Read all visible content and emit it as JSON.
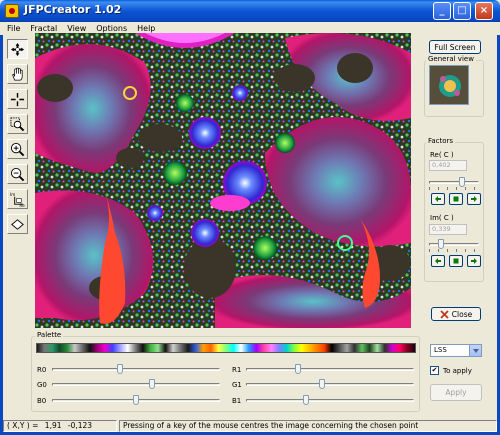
{
  "window": {
    "title": "JFPCreator 1.02"
  },
  "menu": [
    "File",
    "Fractal",
    "View",
    "Options",
    "Help"
  ],
  "toolbar": {
    "tools": [
      {
        "name": "centre-tool",
        "icon": "move-arrows-icon",
        "active": true
      },
      {
        "name": "pan-tool",
        "icon": "hand-icon"
      },
      {
        "name": "crosshair-tool",
        "icon": "crosshair-icon"
      },
      {
        "name": "zoom-region-tool",
        "icon": "zoom-region-icon"
      },
      {
        "name": "zoom-in-tool",
        "icon": "zoom-in-icon"
      },
      {
        "name": "zoom-out-tool",
        "icon": "zoom-out-icon"
      },
      {
        "name": "im-re-axis-tool",
        "icon": "im-re-axis-icon",
        "axis_im": "Im",
        "axis_re": "Re"
      },
      {
        "name": "rotate-tool",
        "icon": "diamond-icon"
      }
    ]
  },
  "right_panel": {
    "full_screen_label": "Full Screen",
    "general_view_label": "General view",
    "factors_label": "Factors",
    "re_label": "Re( C )",
    "re_value": "0,402",
    "im_label": "Im( C )",
    "im_value": "0,339",
    "re_slider_level": 0.68,
    "im_slider_level": 0.2,
    "close_label": "Close"
  },
  "palette": {
    "label": "Palette",
    "channels": [
      {
        "name": "R0",
        "level": 0.4
      },
      {
        "name": "R1",
        "level": 0.3
      },
      {
        "name": "G0",
        "level": 0.6
      },
      {
        "name": "G1",
        "level": 0.45
      },
      {
        "name": "B0",
        "level": 0.5
      },
      {
        "name": "B1",
        "level": 0.35
      }
    ],
    "selected_option": "LSS",
    "to_apply_label": "To apply",
    "to_apply_checked": true,
    "apply_label": "Apply"
  },
  "status": {
    "coords_label": "( X,Y ) =",
    "x": "1,91",
    "y": "-0,123",
    "message": "Pressing of a key of the mouse centres the image concerning the chosen point"
  },
  "colors": {
    "titlebar": "#0b55d3",
    "window_bg": "#ece9d8",
    "close_red": "#c1391c"
  }
}
